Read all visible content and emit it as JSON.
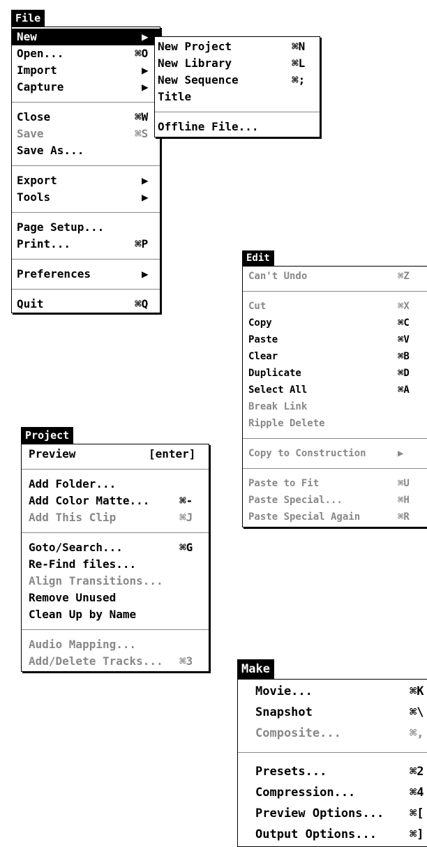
{
  "file": {
    "title": "File",
    "items": [
      {
        "label": "New",
        "submenu": true
      },
      {
        "label": "Open...",
        "shortcut": "⌘O"
      },
      {
        "label": "Import",
        "submenu": true
      },
      {
        "label": "Capture",
        "submenu": true
      },
      {
        "label": "Close",
        "shortcut": "⌘W"
      },
      {
        "label": "Save",
        "shortcut": "⌘S",
        "disabled": true
      },
      {
        "label": "Save As..."
      },
      {
        "label": "Export",
        "submenu": true
      },
      {
        "label": "Tools",
        "submenu": true
      },
      {
        "label": "Page Setup..."
      },
      {
        "label": "Print...",
        "shortcut": "⌘P"
      },
      {
        "label": "Preferences",
        "submenu": true
      },
      {
        "label": "Quit",
        "shortcut": "⌘Q"
      }
    ],
    "submenu_new": [
      {
        "label": "New Project",
        "shortcut": "⌘N"
      },
      {
        "label": "New Library",
        "shortcut": "⌘L"
      },
      {
        "label": "New Sequence",
        "shortcut": "⌘;"
      },
      {
        "label": "Title"
      },
      {
        "label": "Offline File..."
      }
    ]
  },
  "edit": {
    "title": "Edit",
    "items": [
      {
        "label": "Can't Undo",
        "shortcut": "⌘Z",
        "disabled": true
      },
      {
        "label": "Cut",
        "shortcut": "⌘X",
        "disabled": true
      },
      {
        "label": "Copy",
        "shortcut": "⌘C"
      },
      {
        "label": "Paste",
        "shortcut": "⌘V"
      },
      {
        "label": "Clear",
        "shortcut": "⌘B"
      },
      {
        "label": "Duplicate",
        "shortcut": "⌘D"
      },
      {
        "label": "Select All",
        "shortcut": "⌘A"
      },
      {
        "label": "Break Link",
        "disabled": true
      },
      {
        "label": "Ripple Delete",
        "disabled": true
      },
      {
        "label": "Copy to Construction",
        "disabled": true,
        "submenu": true
      },
      {
        "label": "Paste to Fit",
        "shortcut": "⌘U",
        "disabled": true
      },
      {
        "label": "Paste Special...",
        "shortcut": "⌘H",
        "disabled": true
      },
      {
        "label": "Paste Special Again",
        "shortcut": "⌘R",
        "disabled": true
      }
    ]
  },
  "project": {
    "title": "Project",
    "items": [
      {
        "label": "Preview",
        "shortcut": "[enter]"
      },
      {
        "label": "Add Folder..."
      },
      {
        "label": "Add Color Matte...",
        "shortcut": "⌘-"
      },
      {
        "label": "Add This Clip",
        "shortcut": "⌘J",
        "disabled": true
      },
      {
        "label": "Goto/Search...",
        "shortcut": "⌘G"
      },
      {
        "label": "Re-Find files..."
      },
      {
        "label": "Align Transitions...",
        "disabled": true
      },
      {
        "label": "Remove Unused"
      },
      {
        "label": "Clean Up by Name"
      },
      {
        "label": "Audio Mapping...",
        "disabled": true
      },
      {
        "label": "Add/Delete Tracks...",
        "shortcut": "⌘3",
        "disabled": true
      }
    ]
  },
  "make": {
    "title": "Make",
    "items": [
      {
        "label": "Movie...",
        "shortcut": "⌘K"
      },
      {
        "label": "Snapshot",
        "shortcut": "⌘\\"
      },
      {
        "label": "Composite...",
        "shortcut": "⌘,",
        "disabled": true
      },
      {
        "label": "Presets...",
        "shortcut": "⌘2"
      },
      {
        "label": "Compression...",
        "shortcut": "⌘4"
      },
      {
        "label": "Preview Options...",
        "shortcut": "⌘["
      },
      {
        "label": "Output Options...",
        "shortcut": "⌘]"
      }
    ]
  },
  "icons": {
    "submenu_arrow": "triangle-right-icon"
  }
}
